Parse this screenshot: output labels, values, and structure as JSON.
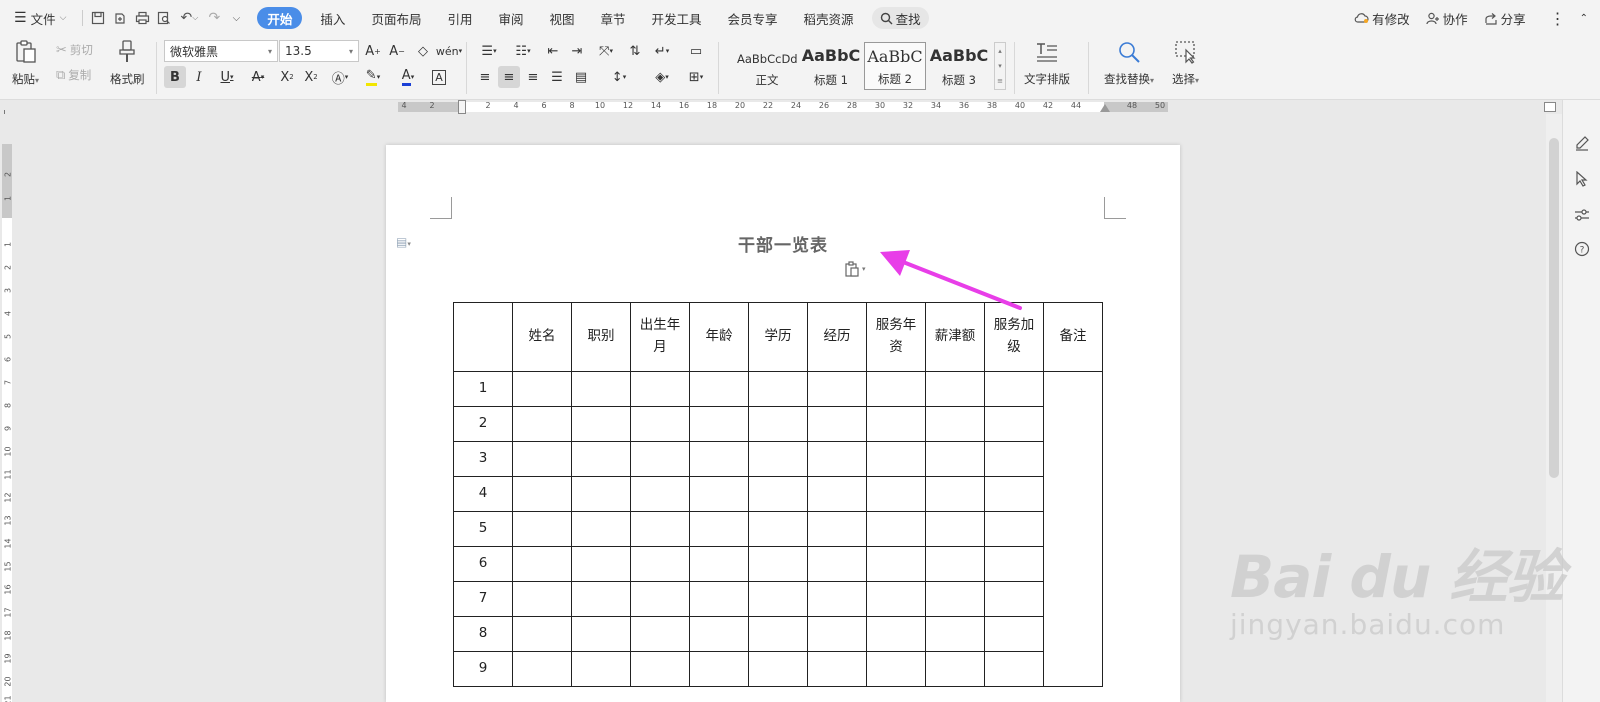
{
  "menubar": {
    "file": "文件",
    "tabs": [
      "开始",
      "插入",
      "页面布局",
      "引用",
      "审阅",
      "视图",
      "章节",
      "开发工具",
      "会员专享",
      "稻壳资源"
    ],
    "active_tab_index": 0,
    "search_label": "查找",
    "right": {
      "modified": "有修改",
      "collab": "协作",
      "share": "分享"
    }
  },
  "ribbon": {
    "paste": "粘贴",
    "cut": "剪切",
    "copy": "复制",
    "format_painter": "格式刷",
    "font_name": "微软雅黑",
    "font_size": "13.5",
    "styles": [
      {
        "sample": "AaBbCcDd",
        "name": "正文"
      },
      {
        "sample": "AaBbC",
        "name": "标题 1"
      },
      {
        "sample": "AaBbC",
        "name": "标题 2"
      },
      {
        "sample": "AaBbC",
        "name": "标题 3"
      }
    ],
    "selected_style_index": 2,
    "text_layout": "文字排版",
    "find_replace": "查找替换",
    "select": "选择",
    "pressed": [
      "bold",
      "align-center"
    ]
  },
  "ruler": {
    "h_ticks": [
      "4",
      "2",
      "2",
      "4",
      "6",
      "8",
      "10",
      "12",
      "14",
      "16",
      "18",
      "20",
      "22",
      "24",
      "26",
      "28",
      "30",
      "32",
      "34",
      "36",
      "38",
      "40",
      "42",
      "44",
      "48",
      "50"
    ],
    "v_ticks": [
      "2",
      "1",
      "1",
      "2",
      "3",
      "4",
      "5",
      "6",
      "7",
      "8",
      "9",
      "10",
      "11",
      "12",
      "13",
      "14",
      "15",
      "16",
      "17",
      "18",
      "19",
      "20",
      "21"
    ]
  },
  "document": {
    "title": "干部一览表",
    "table": {
      "headers": [
        "",
        "姓名",
        "职别",
        "出生年月",
        "年龄",
        "学历",
        "经历",
        "服务年资",
        "薪津额",
        "服务加级",
        "备注"
      ],
      "rows": [
        "1",
        "2",
        "3",
        "4",
        "5",
        "6",
        "7",
        "8",
        "9"
      ]
    }
  },
  "watermark": {
    "logo": "Bai du 经验",
    "url": "jingyan.baidu.com"
  },
  "colors": {
    "accent": "#4a8de8",
    "arrow": "#e83ee8"
  }
}
